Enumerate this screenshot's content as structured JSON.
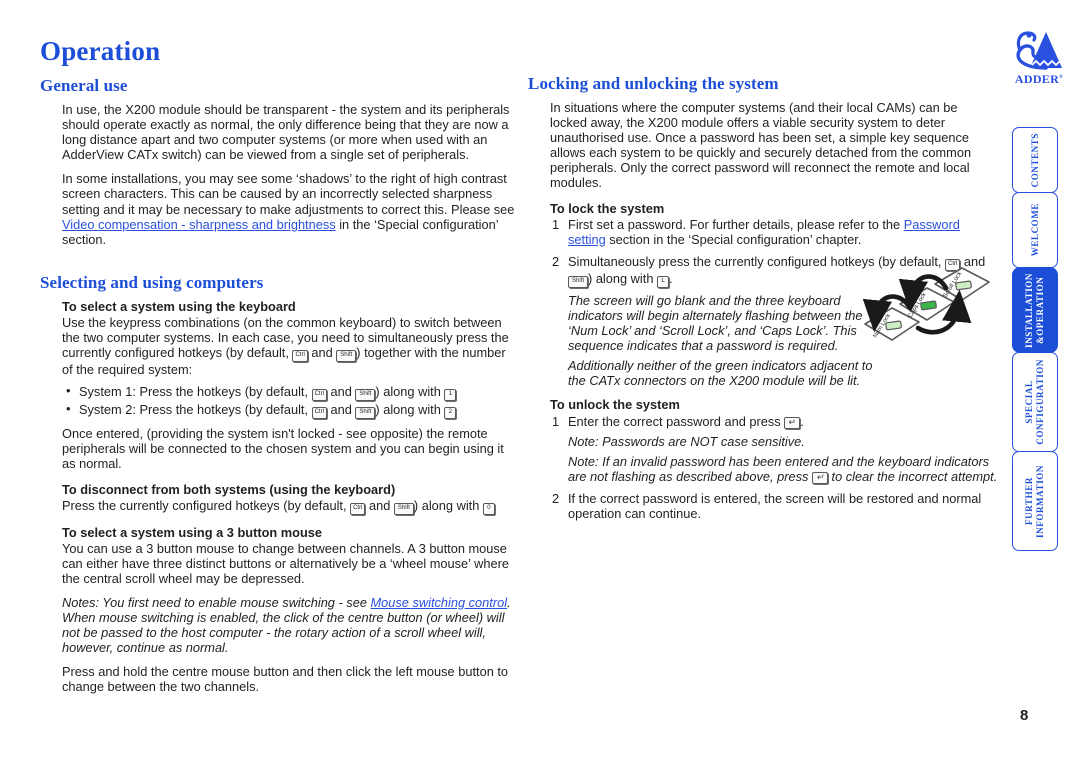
{
  "chapter": {
    "title": "Operation"
  },
  "page": {
    "number": "8"
  },
  "brand": {
    "name": "ADDER",
    "trademark": "®"
  },
  "left_column": {
    "general_use": {
      "heading": "General use",
      "para1": "In use, the X200 module should be transparent - the system and its peripherals should operate exactly as normal, the only difference being that they are now a long distance apart and two computer systems (or more when used with an AdderView CATx switch) can be viewed from a single set of peripherals.",
      "para2_before_link": "In some installations, you may see some ‘shadows’ to the right of high contrast screen characters. This can be caused by an incorrectly selected sharpness setting and it may be necessary to make adjustments to correct this. Please see ",
      "para2_link": "Video compensation - sharpness and brightness",
      "para2_after_link": " in the ‘Special configuration’ section."
    },
    "selecting": {
      "heading": "Selecting and using computers",
      "sub1_heading": "To select a system using the keyboard",
      "sub1_para_a": "Use the keypress combinations (on the common keyboard) to switch between the two computer systems. In each case, you need to simultaneously press the currently configured hotkeys (by default, ",
      "sub1_para_b": " and ",
      "sub1_para_c": ") together with the number of the required system:",
      "bullet1_a": "System 1: Press the hotkeys (by default, ",
      "bullet1_b": " and ",
      "bullet1_c": ") along with ",
      "bullet1_key": "1",
      "bullet2_a": "System 2: Press the hotkeys (by default, ",
      "bullet2_b": " and ",
      "bullet2_c": ") along with ",
      "bullet2_key": "2",
      "after_bullets": "Once entered, (providing the system isn't locked - see opposite) the remote peripherals will be connected to the chosen system and you can begin using it as normal.",
      "sub2_heading": "To disconnect from both systems (using the keyboard)",
      "sub2_para_a": "Press the currently configured hotkeys (by default, ",
      "sub2_para_b": " and ",
      "sub2_para_c": ") along with ",
      "sub2_key": "0",
      "sub3_heading": "To select a system using a 3 button mouse",
      "sub3_para1": "You can use a 3 button mouse to change between channels. A 3 button mouse can either have three distinct buttons or alternatively be a ‘wheel mouse’ where the central scroll wheel may be depressed.",
      "sub3_note_before": "Notes: You first need to enable mouse switching - see ",
      "sub3_note_link": "Mouse switching control",
      "sub3_note_after": ". When mouse switching is enabled, the click of the centre button (or wheel) will not be passed to the host computer - the rotary action of a scroll wheel will, however, continue as normal.",
      "sub3_para2": "Press and hold the centre mouse button and then click the left mouse button to change between the two channels."
    }
  },
  "right_column": {
    "locking": {
      "heading": "Locking and unlocking the system",
      "intro": "In situations where the computer systems (and their local CAMs) can be locked away, the X200 module offers a viable security system to deter unauthorised use. Once a password has been set, a simple key sequence allows each system to be quickly and securely detached from the common peripherals. Only the correct password will reconnect the remote and local modules.",
      "lock_heading": "To lock the system",
      "lock_item1_before": "First set a password. For further details, please refer to the ",
      "lock_item1_link": "Password setting",
      "lock_item1_after": " section in the ‘Special configuration’ chapter.",
      "lock_item2_a": "Simultaneously press the currently configured hotkeys (by default, ",
      "lock_item2_b": " and ",
      "lock_item2_c": ") along with ",
      "lock_item2_key": "L",
      "lock_item2_end": ".",
      "lock_note1": "The screen will go blank and the three keyboard indicators will begin alternately flashing between the ‘Num Lock’ and ‘Scroll Lock’, and ‘Caps Lock’. This sequence indicates that a password is required.",
      "lock_note2": "Additionally neither of the green indicators adjacent to the CATx connectors on the X200 module will be lit.",
      "unlock_heading": "To unlock the system",
      "unlock_item1_before": "Enter the correct password and press ",
      "unlock_item1_after": ".",
      "unlock_note1": "Note: Passwords are NOT case sensitive.",
      "unlock_note2_before": "Note: If an invalid password has been entered and the keyboard indicators are not flashing as described above, press ",
      "unlock_note2_after": " to clear the incorrect attempt.",
      "unlock_item2": "If the correct password is entered, the screen will be restored and normal operation can continue."
    },
    "diagram": {
      "led_labels": [
        "Num Lock",
        "Caps Lock",
        "Scroll Lock"
      ]
    }
  },
  "keys": {
    "ctrl": "Ctrl",
    "shift": "Shift",
    "enter": "↵"
  },
  "tabs": [
    {
      "label": "CONTENTS",
      "active": false,
      "height": 66
    },
    {
      "label": "WELCOME",
      "active": false,
      "height": 76
    },
    {
      "label": "INSTALLATION\n&OPERATION",
      "active": true,
      "height": 86
    },
    {
      "label": "SPECIAL\nCONFIGURATION",
      "active": false,
      "height": 100
    },
    {
      "label": "FURTHER\nINFORMATION",
      "active": false,
      "height": 100
    }
  ],
  "colors": {
    "accent_blue": "#1c4ed8",
    "link_blue": "#2a50e0",
    "body_text": "#231f20",
    "led_green": "#39b54a"
  }
}
